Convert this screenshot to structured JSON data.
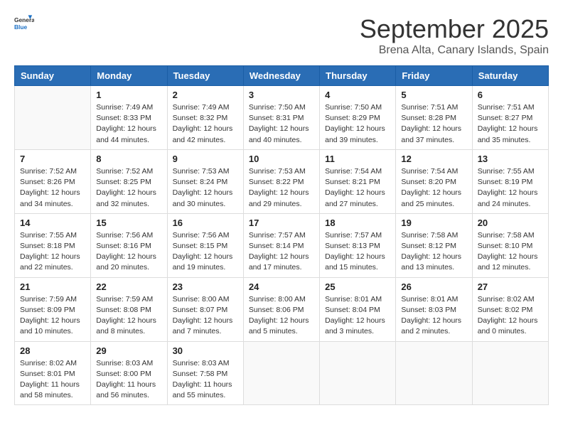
{
  "header": {
    "logo_general": "General",
    "logo_blue": "Blue",
    "month": "September 2025",
    "location": "Brena Alta, Canary Islands, Spain"
  },
  "weekdays": [
    "Sunday",
    "Monday",
    "Tuesday",
    "Wednesday",
    "Thursday",
    "Friday",
    "Saturday"
  ],
  "weeks": [
    [
      {
        "day": "",
        "info": ""
      },
      {
        "day": "1",
        "info": "Sunrise: 7:49 AM\nSunset: 8:33 PM\nDaylight: 12 hours\nand 44 minutes."
      },
      {
        "day": "2",
        "info": "Sunrise: 7:49 AM\nSunset: 8:32 PM\nDaylight: 12 hours\nand 42 minutes."
      },
      {
        "day": "3",
        "info": "Sunrise: 7:50 AM\nSunset: 8:31 PM\nDaylight: 12 hours\nand 40 minutes."
      },
      {
        "day": "4",
        "info": "Sunrise: 7:50 AM\nSunset: 8:29 PM\nDaylight: 12 hours\nand 39 minutes."
      },
      {
        "day": "5",
        "info": "Sunrise: 7:51 AM\nSunset: 8:28 PM\nDaylight: 12 hours\nand 37 minutes."
      },
      {
        "day": "6",
        "info": "Sunrise: 7:51 AM\nSunset: 8:27 PM\nDaylight: 12 hours\nand 35 minutes."
      }
    ],
    [
      {
        "day": "7",
        "info": "Sunrise: 7:52 AM\nSunset: 8:26 PM\nDaylight: 12 hours\nand 34 minutes."
      },
      {
        "day": "8",
        "info": "Sunrise: 7:52 AM\nSunset: 8:25 PM\nDaylight: 12 hours\nand 32 minutes."
      },
      {
        "day": "9",
        "info": "Sunrise: 7:53 AM\nSunset: 8:24 PM\nDaylight: 12 hours\nand 30 minutes."
      },
      {
        "day": "10",
        "info": "Sunrise: 7:53 AM\nSunset: 8:22 PM\nDaylight: 12 hours\nand 29 minutes."
      },
      {
        "day": "11",
        "info": "Sunrise: 7:54 AM\nSunset: 8:21 PM\nDaylight: 12 hours\nand 27 minutes."
      },
      {
        "day": "12",
        "info": "Sunrise: 7:54 AM\nSunset: 8:20 PM\nDaylight: 12 hours\nand 25 minutes."
      },
      {
        "day": "13",
        "info": "Sunrise: 7:55 AM\nSunset: 8:19 PM\nDaylight: 12 hours\nand 24 minutes."
      }
    ],
    [
      {
        "day": "14",
        "info": "Sunrise: 7:55 AM\nSunset: 8:18 PM\nDaylight: 12 hours\nand 22 minutes."
      },
      {
        "day": "15",
        "info": "Sunrise: 7:56 AM\nSunset: 8:16 PM\nDaylight: 12 hours\nand 20 minutes."
      },
      {
        "day": "16",
        "info": "Sunrise: 7:56 AM\nSunset: 8:15 PM\nDaylight: 12 hours\nand 19 minutes."
      },
      {
        "day": "17",
        "info": "Sunrise: 7:57 AM\nSunset: 8:14 PM\nDaylight: 12 hours\nand 17 minutes."
      },
      {
        "day": "18",
        "info": "Sunrise: 7:57 AM\nSunset: 8:13 PM\nDaylight: 12 hours\nand 15 minutes."
      },
      {
        "day": "19",
        "info": "Sunrise: 7:58 AM\nSunset: 8:12 PM\nDaylight: 12 hours\nand 13 minutes."
      },
      {
        "day": "20",
        "info": "Sunrise: 7:58 AM\nSunset: 8:10 PM\nDaylight: 12 hours\nand 12 minutes."
      }
    ],
    [
      {
        "day": "21",
        "info": "Sunrise: 7:59 AM\nSunset: 8:09 PM\nDaylight: 12 hours\nand 10 minutes."
      },
      {
        "day": "22",
        "info": "Sunrise: 7:59 AM\nSunset: 8:08 PM\nDaylight: 12 hours\nand 8 minutes."
      },
      {
        "day": "23",
        "info": "Sunrise: 8:00 AM\nSunset: 8:07 PM\nDaylight: 12 hours\nand 7 minutes."
      },
      {
        "day": "24",
        "info": "Sunrise: 8:00 AM\nSunset: 8:06 PM\nDaylight: 12 hours\nand 5 minutes."
      },
      {
        "day": "25",
        "info": "Sunrise: 8:01 AM\nSunset: 8:04 PM\nDaylight: 12 hours\nand 3 minutes."
      },
      {
        "day": "26",
        "info": "Sunrise: 8:01 AM\nSunset: 8:03 PM\nDaylight: 12 hours\nand 2 minutes."
      },
      {
        "day": "27",
        "info": "Sunrise: 8:02 AM\nSunset: 8:02 PM\nDaylight: 12 hours\nand 0 minutes."
      }
    ],
    [
      {
        "day": "28",
        "info": "Sunrise: 8:02 AM\nSunset: 8:01 PM\nDaylight: 11 hours\nand 58 minutes."
      },
      {
        "day": "29",
        "info": "Sunrise: 8:03 AM\nSunset: 8:00 PM\nDaylight: 11 hours\nand 56 minutes."
      },
      {
        "day": "30",
        "info": "Sunrise: 8:03 AM\nSunset: 7:58 PM\nDaylight: 11 hours\nand 55 minutes."
      },
      {
        "day": "",
        "info": ""
      },
      {
        "day": "",
        "info": ""
      },
      {
        "day": "",
        "info": ""
      },
      {
        "day": "",
        "info": ""
      }
    ]
  ]
}
